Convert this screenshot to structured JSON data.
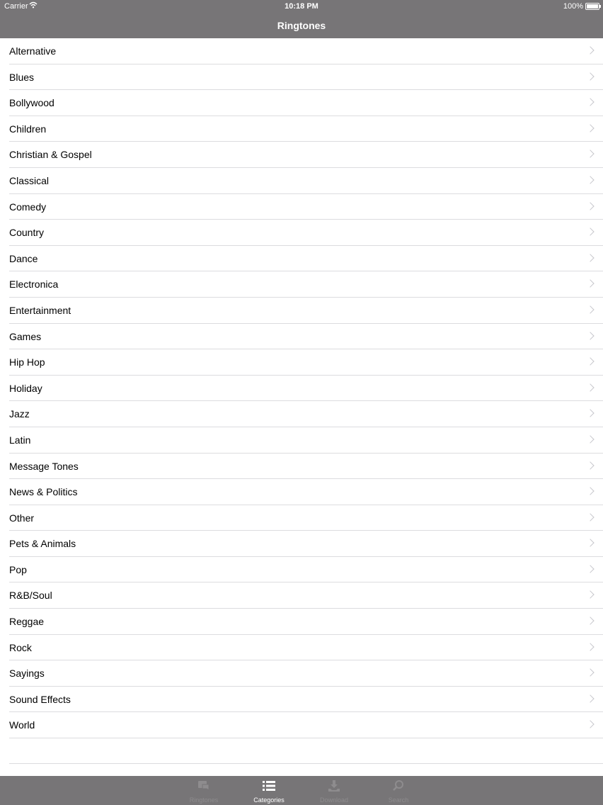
{
  "statusbar": {
    "carrier": "Carrier",
    "time": "10:18 PM",
    "battery": "100%"
  },
  "navbar": {
    "title": "Ringtones"
  },
  "categories": [
    "Alternative",
    "Blues",
    "Bollywood",
    "Children",
    "Christian & Gospel",
    "Classical",
    "Comedy",
    "Country",
    "Dance",
    "Electronica",
    "Entertainment",
    "Games",
    "Hip Hop",
    "Holiday",
    "Jazz",
    "Latin",
    "Message Tones",
    "News & Politics",
    "Other",
    "Pets & Animals",
    "Pop",
    "R&B/Soul",
    "Reggae",
    "Rock",
    "Sayings",
    "Sound Effects",
    "World"
  ],
  "tabbar": {
    "tabs": [
      {
        "label": "Ringtones",
        "icon": "ringtones-icon",
        "active": false
      },
      {
        "label": "Categories",
        "icon": "list-icon",
        "active": true
      },
      {
        "label": "Download",
        "icon": "download-icon",
        "active": false
      },
      {
        "label": "Search",
        "icon": "search-icon",
        "active": false
      }
    ]
  },
  "colors": {
    "bar": "#777577",
    "separator": "#dcdcdf",
    "chevron": "#c7c7cc",
    "inactive_tab": "#8e8c8e",
    "active_tab": "#ffffff"
  }
}
